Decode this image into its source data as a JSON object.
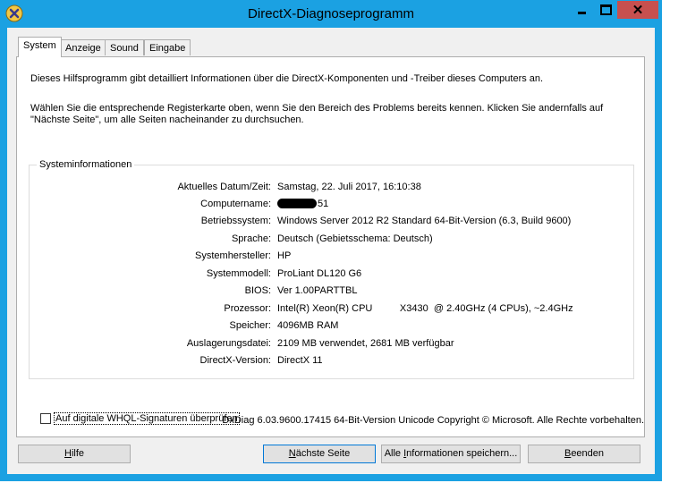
{
  "window": {
    "title": "DirectX-Diagnoseprogramm",
    "accent_color": "#1ba1e2",
    "close_button_color": "#c7504f"
  },
  "tabs": [
    {
      "label": "System",
      "active": true
    },
    {
      "label": "Anzeige",
      "active": false
    },
    {
      "label": "Sound",
      "active": false
    },
    {
      "label": "Eingabe",
      "active": false
    }
  ],
  "intro": {
    "line1": "Dieses Hilfsprogramm gibt detailliert Informationen über die DirectX-Komponenten und -Treiber dieses Computers an.",
    "line2": "Wählen Sie die entsprechende Registerkarte oben, wenn Sie den Bereich des Problems bereits kennen. Klicken Sie andernfalls auf \"Nächste Seite\", um alle Seiten nacheinander zu durchsuchen."
  },
  "system_info": {
    "title": "Systeminformationen",
    "rows": [
      {
        "label": "Aktuelles Datum/Zeit:",
        "value": "Samstag, 22. Juli 2017, 16:10:38"
      },
      {
        "label": "Computername:",
        "value": "51",
        "redacted": true
      },
      {
        "label": "Betriebssystem:",
        "value": "Windows Server 2012 R2 Standard 64-Bit-Version (6.3, Build 9600)"
      },
      {
        "label": "Sprache:",
        "value": "Deutsch (Gebietsschema: Deutsch)"
      },
      {
        "label": "Systemhersteller:",
        "value": "HP"
      },
      {
        "label": "Systemmodell:",
        "value": "ProLiant DL120 G6"
      },
      {
        "label": "BIOS:",
        "value": "Ver 1.00PARTTBL"
      },
      {
        "label": "Prozessor:",
        "value": "Intel(R) Xeon(R) CPU          X3430  @ 2.40GHz (4 CPUs), ~2.4GHz"
      },
      {
        "label": "Speicher:",
        "value": "4096MB RAM"
      },
      {
        "label": "Auslagerungsdatei:",
        "value": "2109 MB verwendet, 2681 MB verfügbar"
      },
      {
        "label": "DirectX-Version:",
        "value": "DirectX 11"
      }
    ]
  },
  "whql_checkbox": {
    "label": "Auf digitale WHQL-Signaturen überprüfen",
    "checked": false
  },
  "copyright": "DxDiag 6.03.9600.17415 64-Bit-Version Unicode Copyright © Microsoft. Alle Rechte vorbehalten.",
  "buttons": {
    "help": {
      "mnemonic": "H",
      "rest": "ilfe"
    },
    "next": {
      "mnemonic": "N",
      "rest": "ächste Seite"
    },
    "save": {
      "pre": "Alle ",
      "mnemonic": "I",
      "rest": "nformationen speichern..."
    },
    "quit": {
      "mnemonic": "B",
      "rest": "eenden"
    }
  },
  "icons": {
    "app": "directx-icon",
    "minimize": "minimize-icon",
    "maximize": "maximize-icon",
    "close": "close-icon"
  }
}
